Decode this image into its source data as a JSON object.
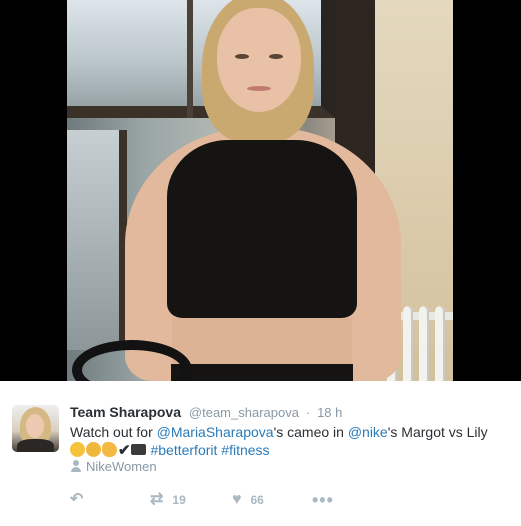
{
  "tweet": {
    "author_name": "Team Sharapova",
    "author_handle": "@team_sharapova",
    "separator": "·",
    "time": "18 h",
    "text": {
      "part1": "Watch out for ",
      "mention1": "@MariaSharapova",
      "part2": "'s cameo in ",
      "mention2": "@nike",
      "part3": "'s Margot vs Lily",
      "check": "✔",
      "hashtag1": "#betterforit",
      "hashtag2": "#fitness"
    },
    "location": "NikeWomen",
    "actions": {
      "retweet_count": "19",
      "like_count": "66"
    }
  },
  "icons": {
    "reply": "reply-icon",
    "retweet": "retweet-icon",
    "like": "heart-icon",
    "more": "more-icon",
    "location": "person-icon"
  },
  "colors": {
    "link": "#2b7bb9",
    "muted": "#8899a6",
    "text": "#292f33"
  }
}
